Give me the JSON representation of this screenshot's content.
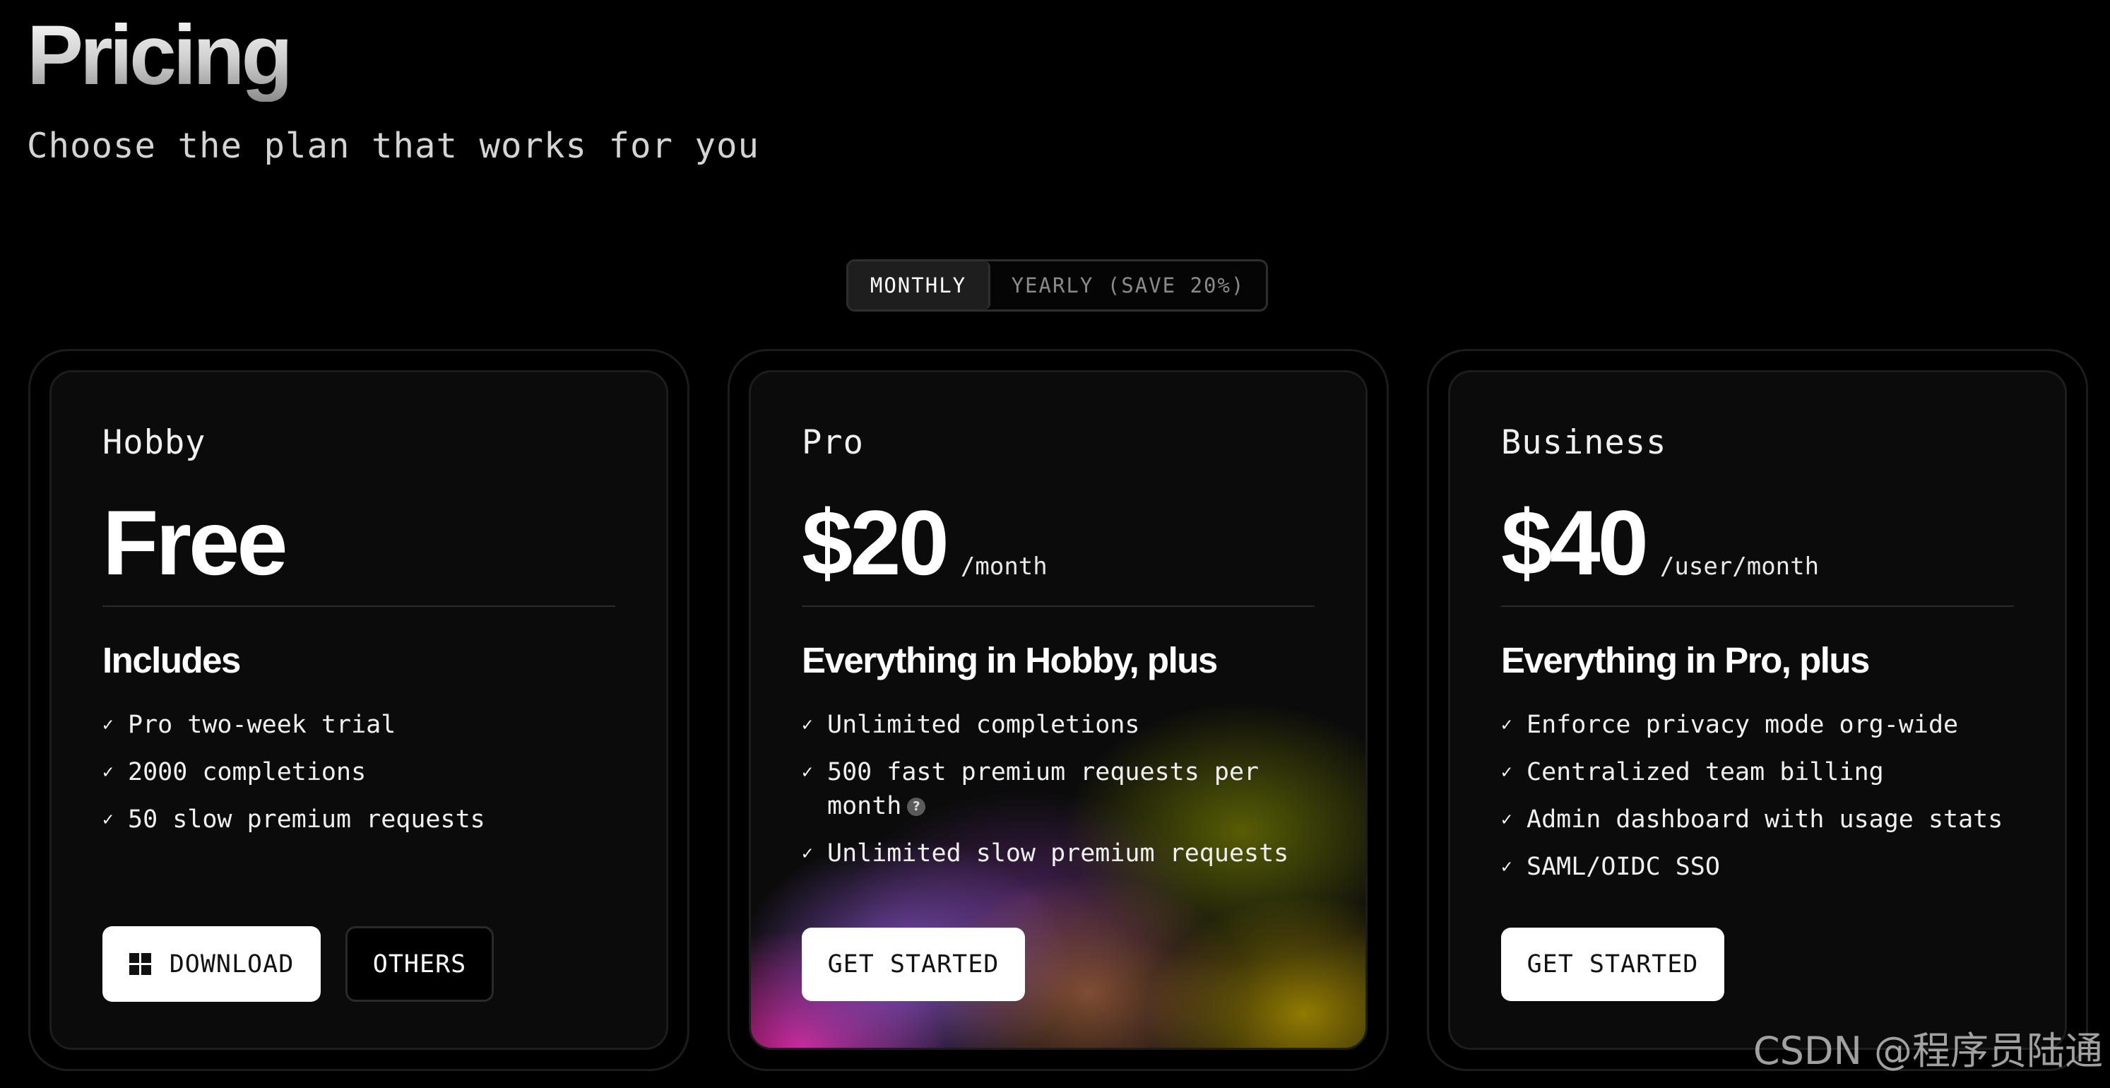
{
  "header": {
    "title": "Pricing",
    "subtitle": "Choose the plan that works for you"
  },
  "billing_toggle": {
    "options": [
      "MONTHLY",
      "YEARLY (SAVE 20%)"
    ],
    "selected": "MONTHLY"
  },
  "plans": [
    {
      "name": "Hobby",
      "price": "Free",
      "unit": "",
      "includes_heading": "Includes",
      "features": [
        "Pro two-week trial",
        "2000 completions",
        "50 slow premium requests"
      ],
      "buttons": [
        {
          "label": "DOWNLOAD",
          "icon": "windows-icon"
        },
        {
          "label": "OTHERS"
        }
      ]
    },
    {
      "name": "Pro",
      "price": "$20",
      "unit": "/month",
      "includes_heading": "Everything in Hobby, plus",
      "features": [
        "Unlimited completions",
        "500 fast premium requests per month",
        "Unlimited slow premium requests"
      ],
      "feature_help_icon": "?",
      "buttons": [
        {
          "label": "GET STARTED"
        }
      ]
    },
    {
      "name": "Business",
      "price": "$40",
      "unit": "/user/month",
      "includes_heading": "Everything in Pro, plus",
      "features": [
        "Enforce privacy mode org-wide",
        "Centralized team billing",
        "Admin dashboard with usage stats",
        "SAML/OIDC SSO"
      ],
      "buttons": [
        {
          "label": "GET STARTED"
        }
      ]
    }
  ],
  "watermark": "CSDN @程序员陆通",
  "colors": {
    "background": "#000000",
    "card": "#0b0b0b",
    "button_light": "#ffffff",
    "pro_gradient": [
      "#d728a0",
      "#965adc",
      "#dc8250",
      "#be9f00"
    ]
  }
}
